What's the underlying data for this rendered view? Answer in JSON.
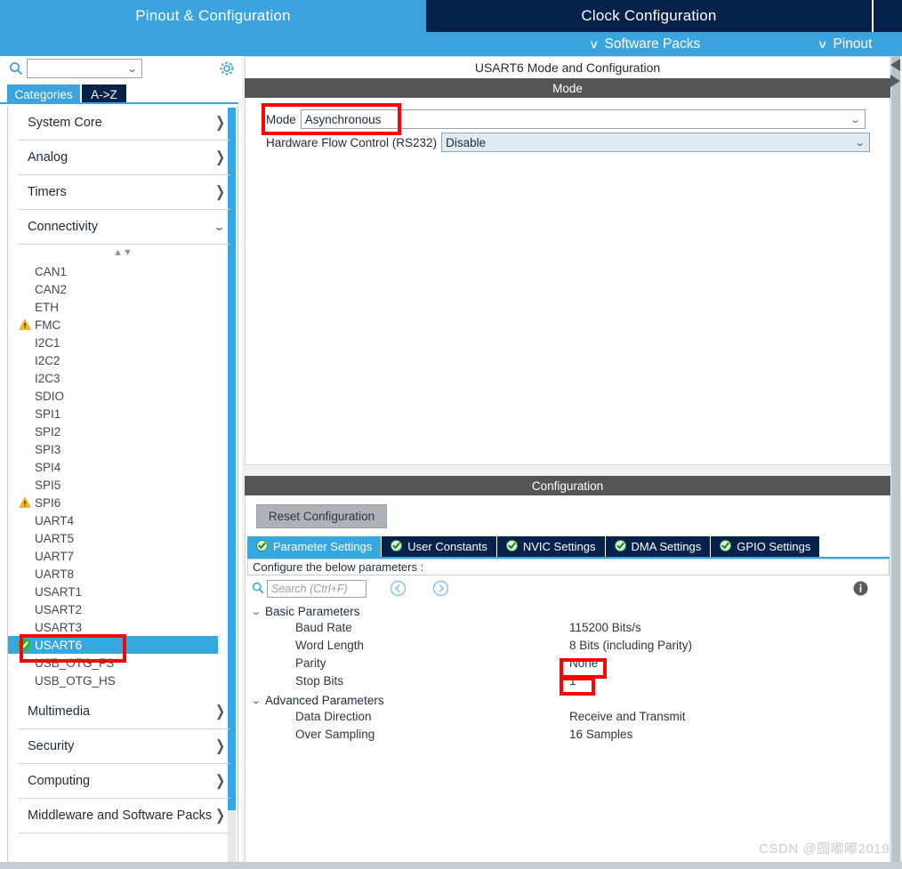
{
  "topbar": {
    "tabs": [
      {
        "label": "Pinout & Configuration",
        "active": true
      },
      {
        "label": "Clock Configuration",
        "active": false
      }
    ]
  },
  "subbar": {
    "software_packs": "Software Packs",
    "pinout": "Pinout",
    "chevron": "∨"
  },
  "sidebar": {
    "search": {
      "placeholder": "",
      "value": ""
    },
    "tabs": [
      {
        "label": "Categories",
        "active": true
      },
      {
        "label": "A->Z",
        "active": false
      }
    ],
    "categories": [
      {
        "label": "System Core",
        "state": "closed"
      },
      {
        "label": "Analog",
        "state": "closed"
      },
      {
        "label": "Timers",
        "state": "closed"
      },
      {
        "label": "Connectivity",
        "state": "open"
      }
    ],
    "peripherals": [
      {
        "label": "CAN1",
        "status": "none"
      },
      {
        "label": "CAN2",
        "status": "none"
      },
      {
        "label": "ETH",
        "status": "none"
      },
      {
        "label": "FMC",
        "status": "warning"
      },
      {
        "label": "I2C1",
        "status": "none"
      },
      {
        "label": "I2C2",
        "status": "none"
      },
      {
        "label": "I2C3",
        "status": "none"
      },
      {
        "label": "SDIO",
        "status": "none"
      },
      {
        "label": "SPI1",
        "status": "none"
      },
      {
        "label": "SPI2",
        "status": "none"
      },
      {
        "label": "SPI3",
        "status": "none"
      },
      {
        "label": "SPI4",
        "status": "none"
      },
      {
        "label": "SPI5",
        "status": "none"
      },
      {
        "label": "SPI6",
        "status": "warning"
      },
      {
        "label": "UART4",
        "status": "none"
      },
      {
        "label": "UART5",
        "status": "none"
      },
      {
        "label": "UART7",
        "status": "none"
      },
      {
        "label": "UART8",
        "status": "none"
      },
      {
        "label": "USART1",
        "status": "none"
      },
      {
        "label": "USART2",
        "status": "none"
      },
      {
        "label": "USART3",
        "status": "none"
      },
      {
        "label": "USART6",
        "status": "enabled",
        "selected": true
      },
      {
        "label": "USB_OTG_FS",
        "status": "none"
      },
      {
        "label": "USB_OTG_HS",
        "status": "none"
      }
    ],
    "categories_bottom": [
      {
        "label": "Multimedia",
        "state": "closed"
      },
      {
        "label": "Security",
        "state": "closed"
      },
      {
        "label": "Computing",
        "state": "closed"
      },
      {
        "label": "Middleware and Software Packs",
        "state": "closed"
      }
    ]
  },
  "panel": {
    "title": "USART6 Mode and Configuration",
    "mode_header": "Mode",
    "mode_field_label": "Mode",
    "mode_field_value": "Asynchronous",
    "flow_field_label": "Hardware Flow Control (RS232)",
    "flow_field_value": "Disable",
    "config_header": "Configuration",
    "reset_button": "Reset Configuration",
    "tabs": [
      {
        "label": "Parameter Settings",
        "active": true
      },
      {
        "label": "User Constants",
        "active": false
      },
      {
        "label": "NVIC Settings",
        "active": false
      },
      {
        "label": "DMA Settings",
        "active": false
      },
      {
        "label": "GPIO Settings",
        "active": false
      }
    ],
    "hint": "Configure the below parameters :",
    "search_placeholder": "Search (Ctrl+F)",
    "param_sections": [
      {
        "title": "Basic Parameters",
        "state": "open",
        "rows": [
          {
            "name": "Baud Rate",
            "value": "115200 Bits/s"
          },
          {
            "name": "Word Length",
            "value": "8 Bits (including Parity)"
          },
          {
            "name": "Parity",
            "value": "None"
          },
          {
            "name": "Stop Bits",
            "value": "1"
          }
        ]
      },
      {
        "title": "Advanced Parameters",
        "state": "open",
        "rows": [
          {
            "name": "Data Direction",
            "value": "Receive and Transmit"
          },
          {
            "name": "Over Sampling",
            "value": "16 Samples"
          }
        ]
      }
    ]
  },
  "watermark": "CSDN @圆嘟嘟2019",
  "colors": {
    "accent_light_blue": "#3ba3dd",
    "accent_dark_navy": "#06224a",
    "header_gray": "#555555",
    "annotation_red": "#f90505",
    "selection_blue": "#35a8e0",
    "warning_yellow": "#f5b919",
    "ok_green": "#2eb82e"
  }
}
